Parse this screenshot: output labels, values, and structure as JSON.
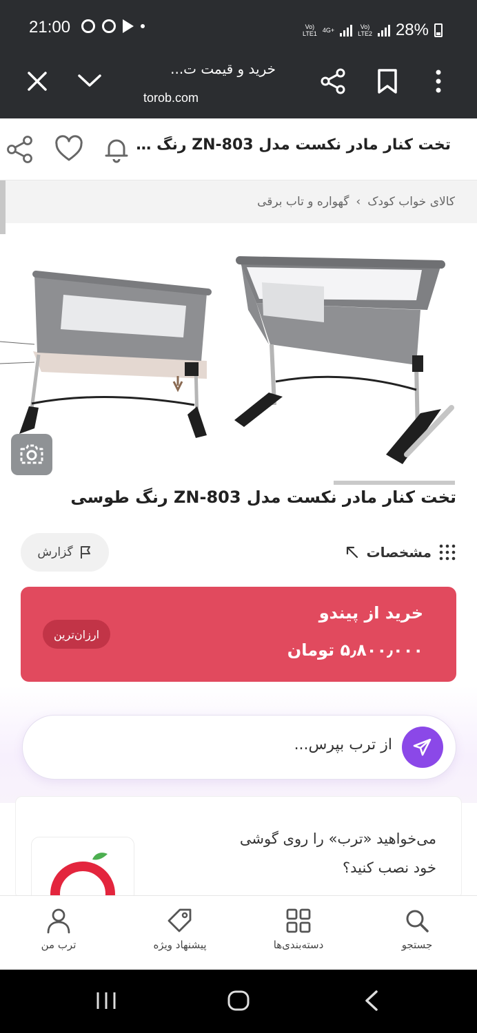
{
  "status_bar": {
    "time": "21:00",
    "net1_label": "Vo)\nLTE1",
    "net_type": "4G+",
    "net2_label": "Vo)\nLTE2",
    "battery": "28%"
  },
  "browser": {
    "tab_title": "خرید و قیمت ت...",
    "domain": "torob.com"
  },
  "page_header": {
    "title": "تخت کنار مادر نکست مدل ZN-803 رنگ طوسی"
  },
  "breadcrumb": {
    "items": [
      "کالای خواب کودک",
      "گهواره و تاب برقی"
    ],
    "separator": "›"
  },
  "product": {
    "title": "تخت کنار مادر نکست مدل ZN-803 رنگ طوسی",
    "specs_label": "مشخصات",
    "report_label": "گزارش"
  },
  "buy": {
    "store": "خرید از پیندو",
    "price": "۵٫۸۰۰٫۰۰۰ تومان",
    "badge": "ارزان‌ترین",
    "color": "#e14a5e"
  },
  "ai": {
    "placeholder": "از ترب بپرس..."
  },
  "install": {
    "line1": "می‌خواهید «ترب» را روی گوشی",
    "line2": "خود نصب کنید؟"
  },
  "bottom_nav": {
    "items": [
      {
        "label": "جستجو",
        "icon": "search-icon"
      },
      {
        "label": "دسته‌بندی‌ها",
        "icon": "grid-icon"
      },
      {
        "label": "پیشنهاد ویژه",
        "icon": "tag-icon"
      },
      {
        "label": "ترب من",
        "icon": "user-icon"
      }
    ]
  },
  "colors": {
    "accent_purple": "#8b48e8",
    "buy_red": "#e14a5e",
    "chrome_dark": "#2b2d30"
  }
}
